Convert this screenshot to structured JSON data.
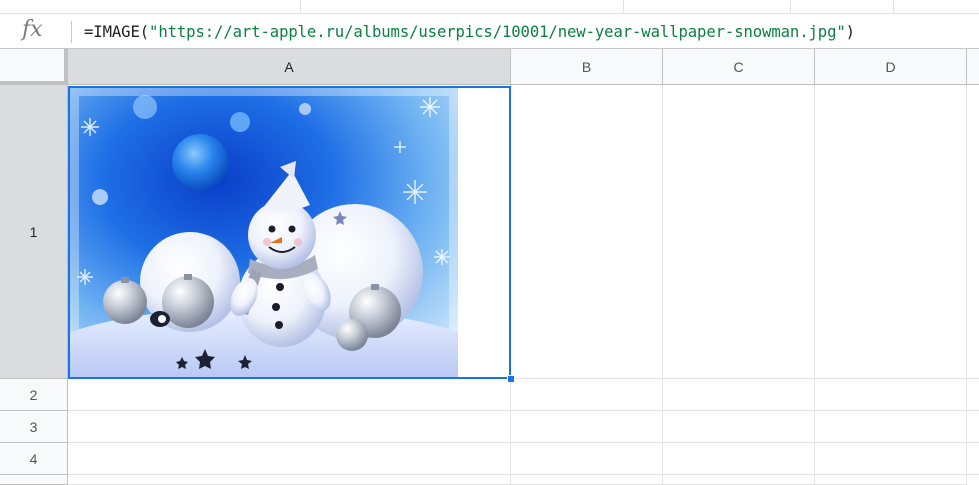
{
  "formula_bar": {
    "fx_icon": "fx",
    "prefix": "=IMAGE(",
    "url_literal": "\"https://art-apple.ru/albums/userpics/10001/new-year-wallpaper-snowman.jpg\"",
    "suffix": ")"
  },
  "columns": [
    "A",
    "B",
    "C",
    "D"
  ],
  "rows": [
    "1",
    "2",
    "3",
    "4"
  ],
  "selected_cell": "A1",
  "cell_a1": {
    "content": "image",
    "image_subject": "snowman-with-ornaments"
  },
  "colors": {
    "selection": "#1a73e8",
    "string_literal": "#0b8043",
    "header_bg": "#f8f9fa",
    "header_selected_bg": "#dadce0"
  }
}
